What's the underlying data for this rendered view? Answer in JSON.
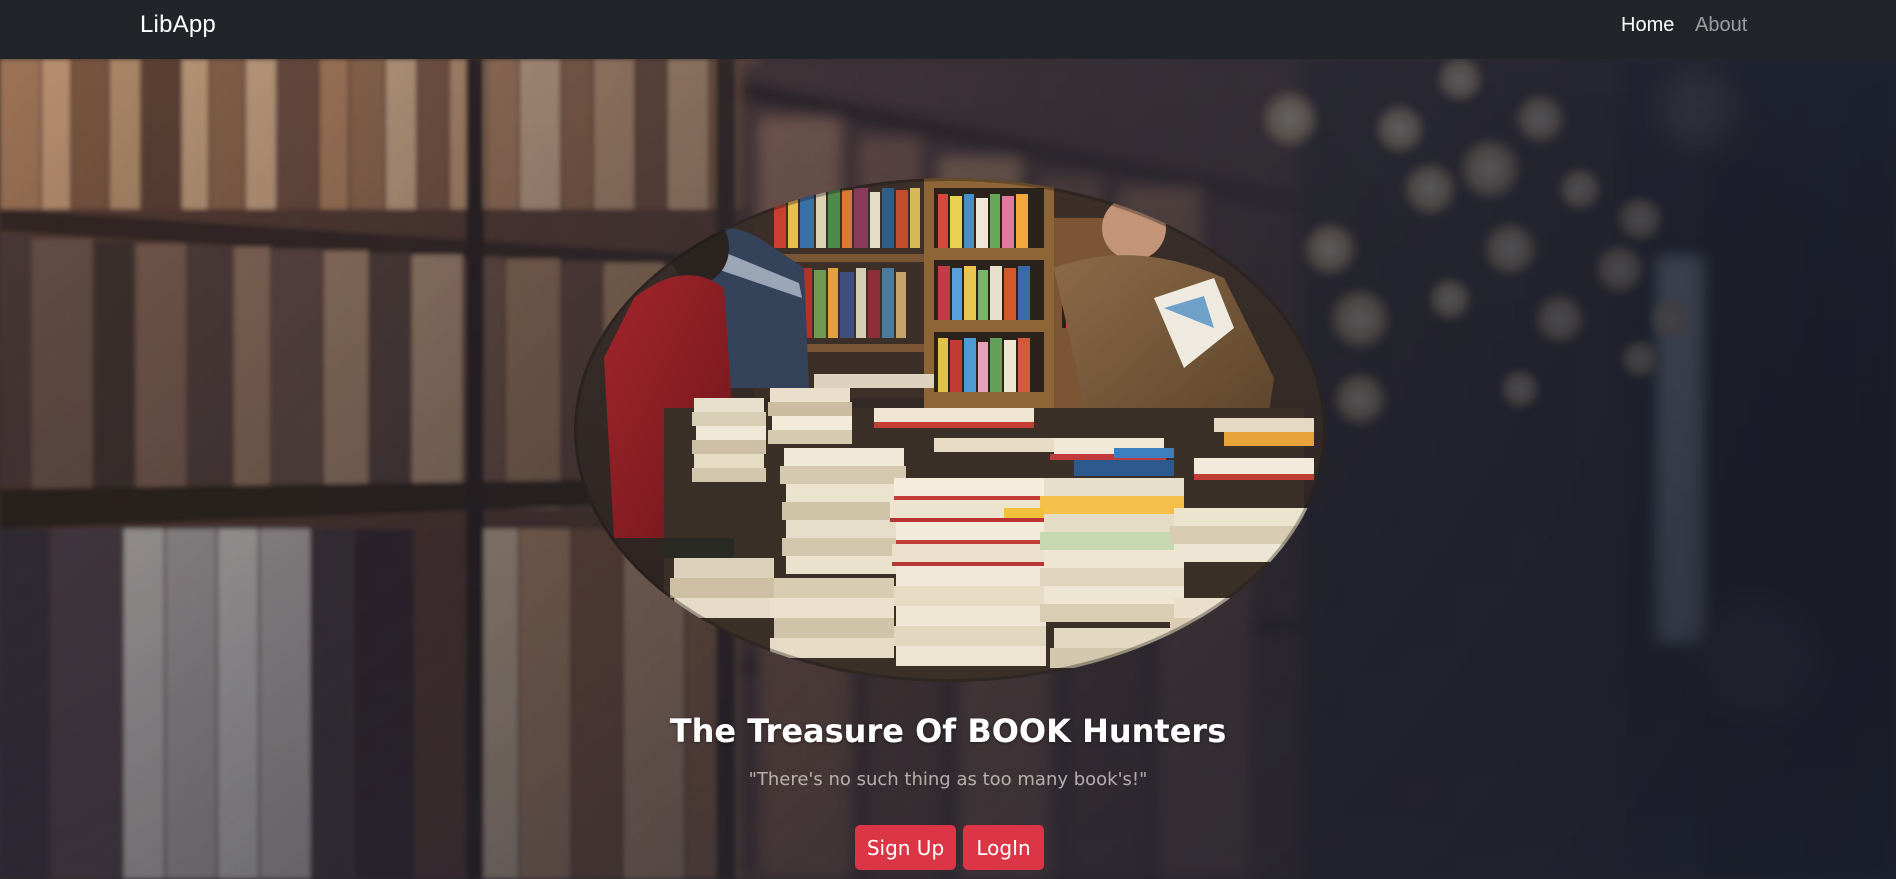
{
  "navbar": {
    "brand": "LibApp",
    "links": [
      {
        "label": "Home",
        "active": true
      },
      {
        "label": "About",
        "active": false
      }
    ],
    "background_color": "#212529"
  },
  "hero": {
    "title": "The Treasure Of BOOK Hunters",
    "quote": "\"There's no such thing as too many book's!\"",
    "buttons": {
      "signup_label": "Sign Up",
      "login_label": "LogIn"
    },
    "button_color": "#dc3545",
    "background_image": "blurred-library-bookshelves",
    "feature_image": "oval-bookshop-photo"
  }
}
